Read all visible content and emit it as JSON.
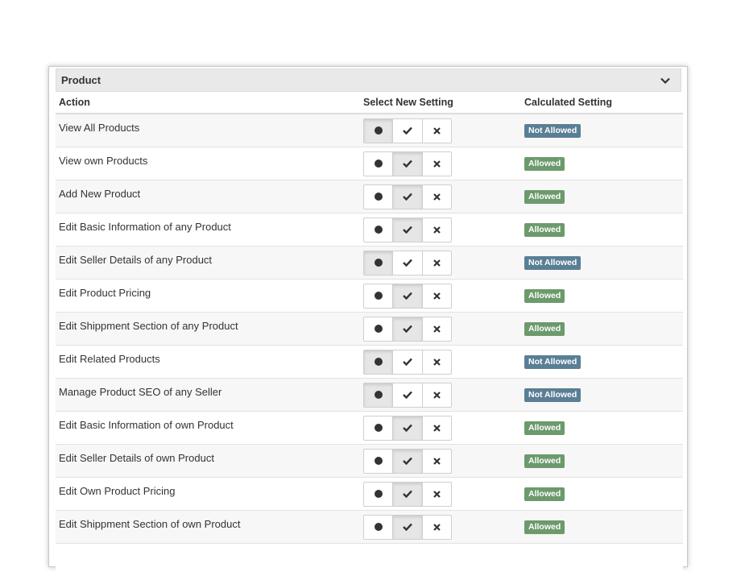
{
  "panel": {
    "title": "Product"
  },
  "columns": {
    "action": "Action",
    "select": "Select New Setting",
    "calculated": "Calculated Setting"
  },
  "status_labels": {
    "allowed": "Allowed",
    "not_allowed": "Not Allowed"
  },
  "colors": {
    "allowed": "#6c9a6c",
    "not_allowed": "#5a7f94"
  },
  "rows": [
    {
      "action": "View All Products",
      "selected": "inherit",
      "calculated": "Not Allowed"
    },
    {
      "action": "View own Products",
      "selected": "allow",
      "calculated": "Allowed"
    },
    {
      "action": "Add New Product",
      "selected": "allow",
      "calculated": "Allowed"
    },
    {
      "action": "Edit Basic Information of any Product",
      "selected": "allow",
      "calculated": "Allowed"
    },
    {
      "action": "Edit Seller Details of any Product",
      "selected": "inherit",
      "calculated": "Not Allowed"
    },
    {
      "action": "Edit Product Pricing",
      "selected": "allow",
      "calculated": "Allowed"
    },
    {
      "action": "Edit Shippment Section of any Product",
      "selected": "allow",
      "calculated": "Allowed"
    },
    {
      "action": "Edit Related Products",
      "selected": "inherit",
      "calculated": "Not Allowed"
    },
    {
      "action": "Manage Product SEO of any Seller",
      "selected": "inherit",
      "calculated": "Not Allowed"
    },
    {
      "action": "Edit Basic Information of own Product",
      "selected": "allow",
      "calculated": "Allowed"
    },
    {
      "action": "Edit Seller Details of own Product",
      "selected": "allow",
      "calculated": "Allowed"
    },
    {
      "action": "Edit Own Product Pricing",
      "selected": "allow",
      "calculated": "Allowed"
    },
    {
      "action": "Edit Shippment Section of own Product",
      "selected": "allow",
      "calculated": "Allowed"
    },
    {
      "action": "",
      "selected": "",
      "calculated": ""
    }
  ]
}
